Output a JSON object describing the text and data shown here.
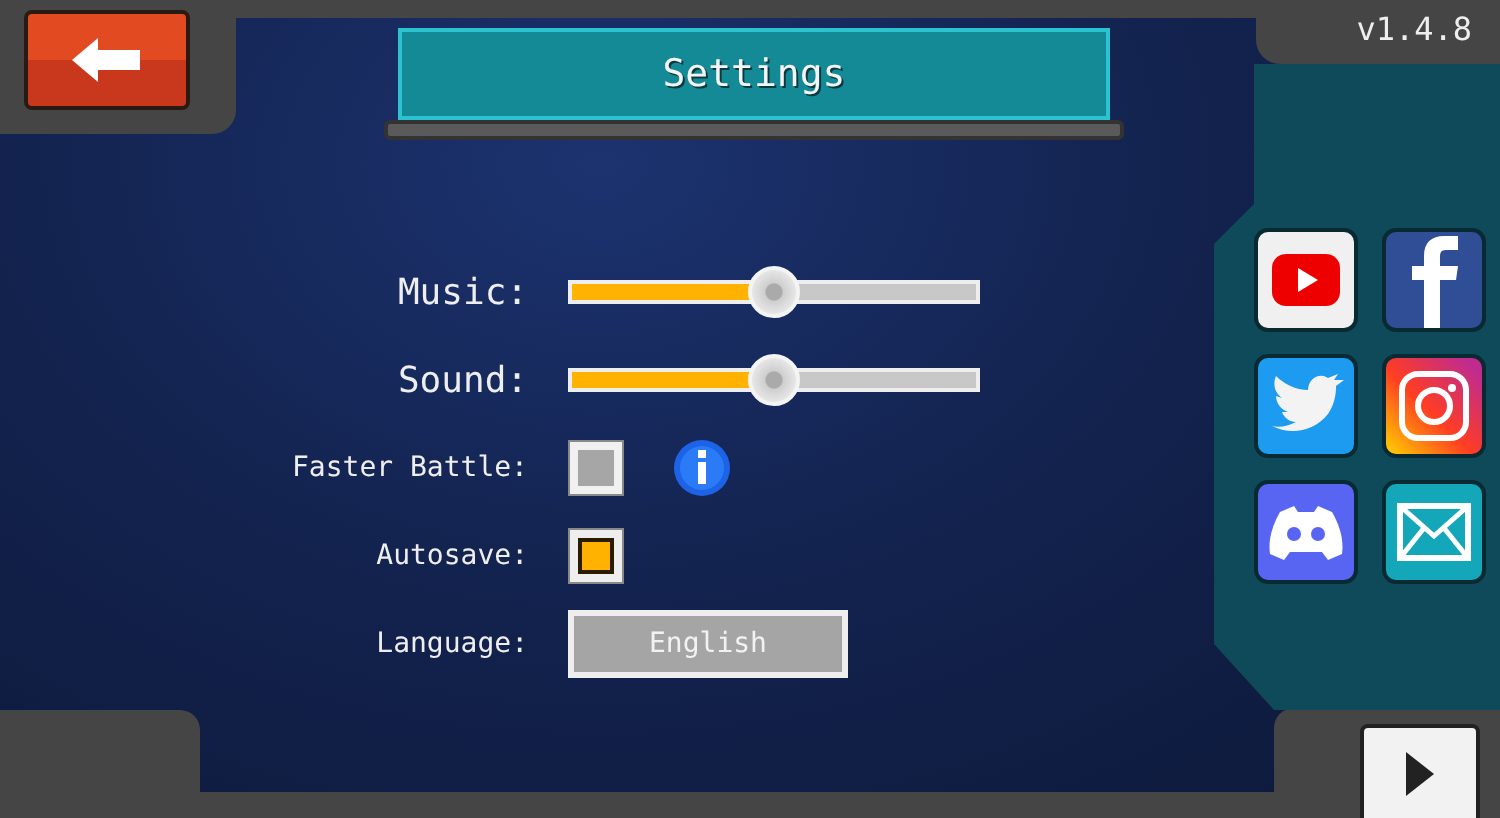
{
  "title": "Settings",
  "version": "v1.4.8",
  "settings": [
    {
      "kind": "slider",
      "label": "Music:",
      "level": 0.5
    },
    {
      "kind": "slider",
      "label": "Sound:",
      "level": 0.5
    },
    {
      "kind": "checkbox",
      "label": "Faster Battle:",
      "checked": false,
      "info": true
    },
    {
      "kind": "checkbox",
      "label": "Autosave:",
      "checked": true,
      "info": false
    },
    {
      "kind": "dropdown",
      "label": "Language:",
      "value": "English"
    }
  ]
}
